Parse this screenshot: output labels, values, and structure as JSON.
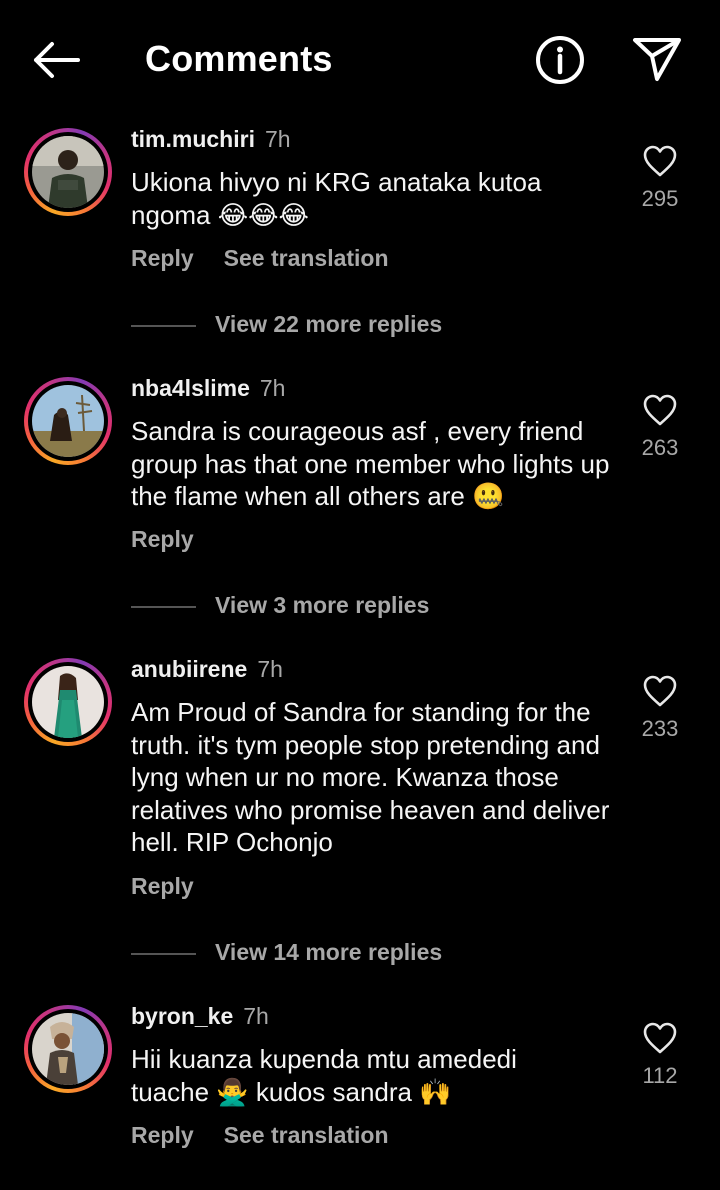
{
  "header": {
    "title": "Comments",
    "icons": [
      "back-arrow-icon",
      "info-icon",
      "send-icon"
    ]
  },
  "comments": [
    {
      "username": "tim.muchiri",
      "time": "7h",
      "text": "Ukiona hivyo ni KRG anataka kutoa ngoma 😂😂😂",
      "likes": "295",
      "reply_label": "Reply",
      "see_translation_label": "See translation",
      "view_replies": "View 22 more replies"
    },
    {
      "username": "nba4lslime",
      "time": "7h",
      "text": "Sandra is courageous asf , every friend group has that one member who lights up the flame when all others are 🤐",
      "likes": "263",
      "reply_label": "Reply",
      "view_replies": "View 3 more replies"
    },
    {
      "username": "anubiirene",
      "time": "7h",
      "text": "Am Proud of Sandra for standing for the truth. it's tym people stop pretending and lyng when ur no more. Kwanza those relatives who promise heaven and deliver hell. RIP Ochonjo",
      "likes": "233",
      "reply_label": "Reply",
      "view_replies": "View 14 more replies"
    },
    {
      "username": "byron_ke",
      "time": "7h",
      "text": "Hii kuanza kupenda mtu amededi tuache 🙅‍♂️ kudos sandra 🙌",
      "likes": "112",
      "reply_label": "Reply",
      "see_translation_label": "See translation"
    }
  ],
  "colors": {
    "background": "#000000",
    "text": "#f5f5f5",
    "muted": "#a8a8a8",
    "ring_start": "#f9a825",
    "ring_end": "#c13584"
  }
}
